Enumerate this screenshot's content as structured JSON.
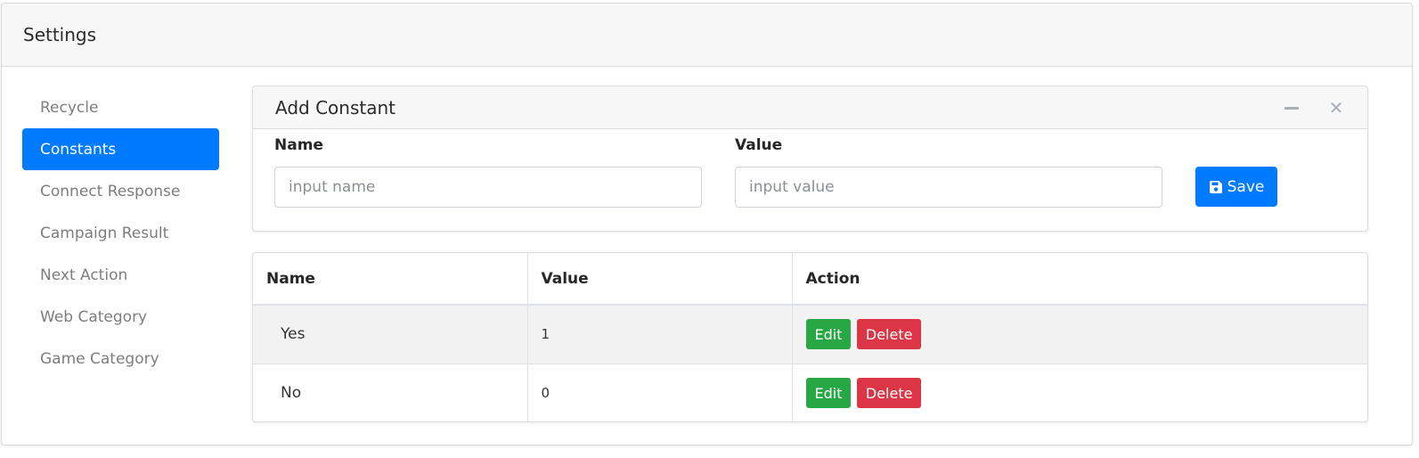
{
  "header": {
    "title": "Settings"
  },
  "sidebar": {
    "items": [
      {
        "label": "Recycle",
        "active": false
      },
      {
        "label": "Constants",
        "active": true
      },
      {
        "label": "Connect Response",
        "active": false
      },
      {
        "label": "Campaign Result",
        "active": false
      },
      {
        "label": "Next Action",
        "active": false
      },
      {
        "label": "Web Category",
        "active": false
      },
      {
        "label": "Game Category",
        "active": false
      }
    ]
  },
  "add_panel": {
    "title": "Add Constant",
    "name_label": "Name",
    "name_placeholder": "input name",
    "value_label": "Value",
    "value_placeholder": "input value",
    "save_label": "Save"
  },
  "table": {
    "headers": [
      "Name",
      "Value",
      "Action"
    ],
    "rows": [
      {
        "name": "Yes",
        "value": "1"
      },
      {
        "name": "No",
        "value": "0"
      }
    ],
    "edit_label": "Edit",
    "delete_label": "Delete"
  },
  "colors": {
    "primary": "#007bff",
    "success": "#28a745",
    "danger": "#dc3545"
  },
  "icons": {
    "minimize": "minus-icon",
    "close": "close-icon",
    "save": "floppy-disk-icon"
  }
}
